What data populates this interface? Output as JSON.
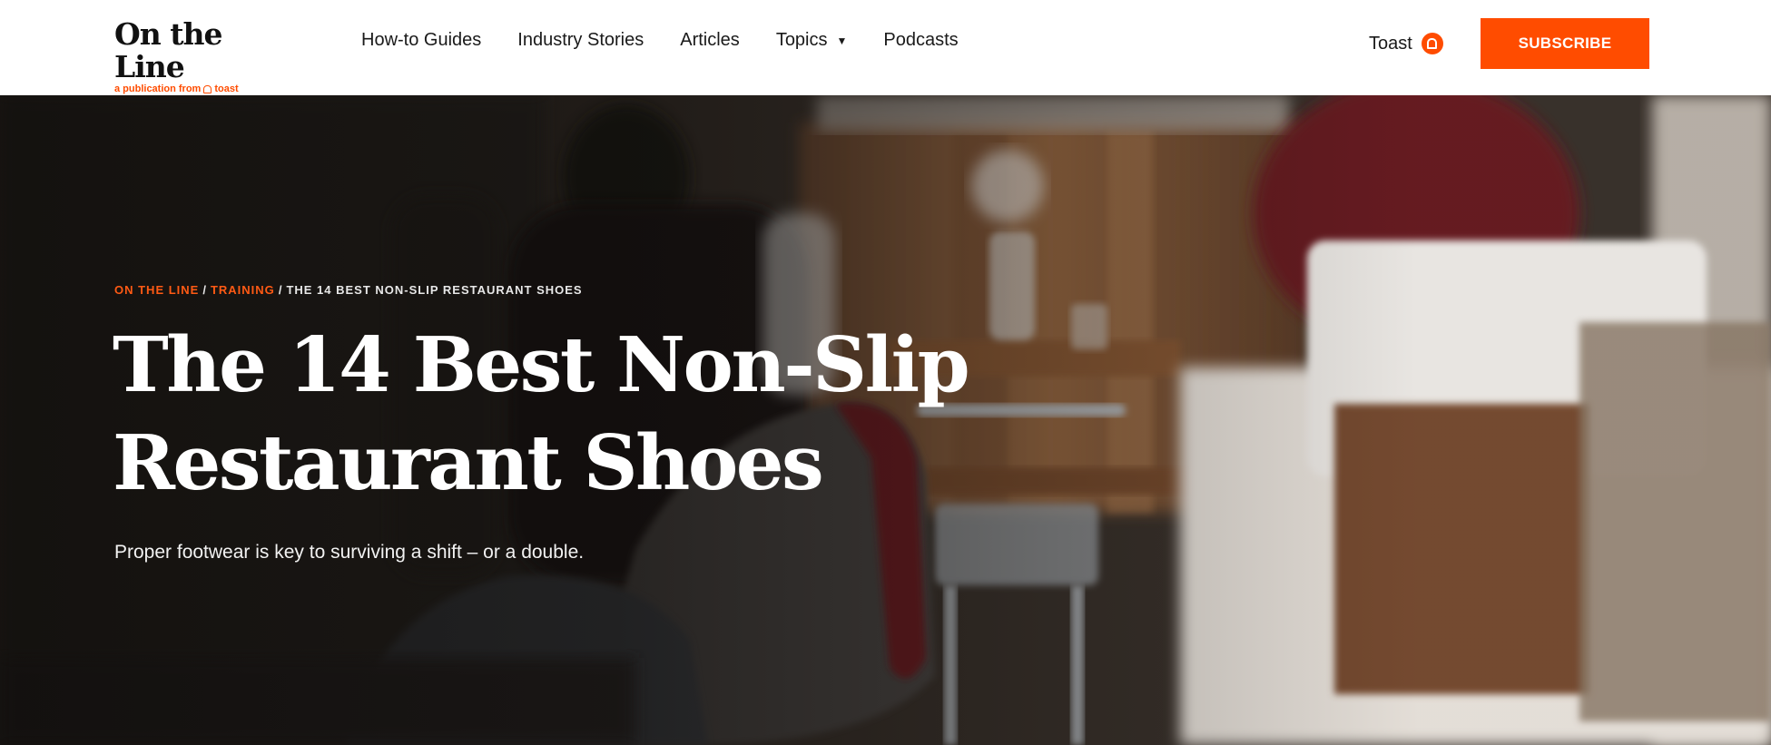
{
  "header": {
    "logo_title": "On the Line",
    "logo_sub_prefix": "a publication from",
    "logo_sub_brand": "toast",
    "nav": [
      {
        "label": "How-to Guides"
      },
      {
        "label": "Industry Stories"
      },
      {
        "label": "Articles"
      },
      {
        "label": "Topics",
        "has_dropdown": true
      },
      {
        "label": "Podcasts"
      }
    ],
    "toast_link": "Toast",
    "subscribe_label": "SUBSCRIBE"
  },
  "hero": {
    "breadcrumb": [
      {
        "label": "ON THE LINE",
        "link": true
      },
      {
        "label": "TRAINING",
        "link": true
      },
      {
        "label": "THE 14 BEST NON-SLIP RESTAURANT SHOES",
        "link": false
      }
    ],
    "title": "The 14 Best Non-Slip Restaurant Shoes",
    "subtitle": "Proper footwear is key to surviving a shift – or a double."
  },
  "colors": {
    "accent": "#ff4c00",
    "header_bg": "#ffffff",
    "hero_text": "#ffffff"
  }
}
